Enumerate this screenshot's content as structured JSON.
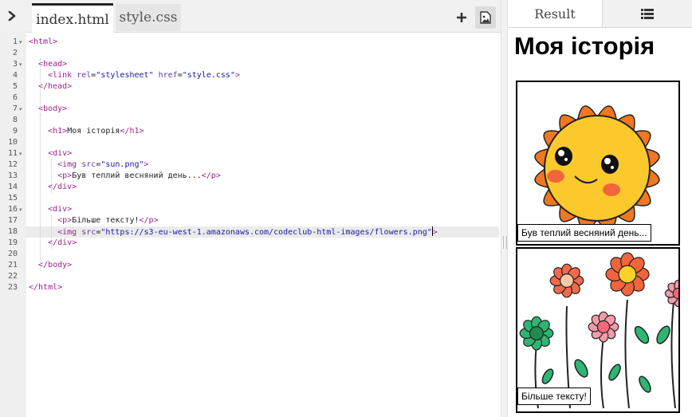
{
  "editor": {
    "tabs": [
      {
        "label": "index.html",
        "active": true
      },
      {
        "label": "style.css",
        "active": false
      }
    ],
    "active_line": 18,
    "lines": [
      {
        "n": "1",
        "fold": true,
        "text": "<html>"
      },
      {
        "n": "2",
        "fold": false,
        "text": ""
      },
      {
        "n": "3",
        "fold": true,
        "text": "  <head>"
      },
      {
        "n": "4",
        "fold": false,
        "text": "    <link rel=\"stylesheet\" href=\"style.css\">"
      },
      {
        "n": "5",
        "fold": false,
        "text": "  </head>"
      },
      {
        "n": "6",
        "fold": false,
        "text": ""
      },
      {
        "n": "7",
        "fold": true,
        "text": "  <body>"
      },
      {
        "n": "8",
        "fold": false,
        "text": ""
      },
      {
        "n": "9",
        "fold": false,
        "text": "    <h1>Моя історія</h1>"
      },
      {
        "n": "10",
        "fold": false,
        "text": ""
      },
      {
        "n": "11",
        "fold": true,
        "text": "    <div>"
      },
      {
        "n": "12",
        "fold": false,
        "text": "      <img src=\"sun.png\">"
      },
      {
        "n": "13",
        "fold": false,
        "text": "      <p>Був теплий весняний день...</p>"
      },
      {
        "n": "14",
        "fold": false,
        "text": "    </div>"
      },
      {
        "n": "15",
        "fold": false,
        "text": ""
      },
      {
        "n": "16",
        "fold": true,
        "text": "    <div>"
      },
      {
        "n": "17",
        "fold": false,
        "text": "      <p>Більше тексту!</p>"
      },
      {
        "n": "18",
        "fold": false,
        "text": "      <img src=\"https://s3-eu-west-1.amazonaws.com/codeclub-html-images/flowers.png\">"
      },
      {
        "n": "19",
        "fold": false,
        "text": "    </div>"
      },
      {
        "n": "20",
        "fold": false,
        "text": ""
      },
      {
        "n": "21",
        "fold": false,
        "text": "  </body>"
      },
      {
        "n": "22",
        "fold": false,
        "text": ""
      },
      {
        "n": "23",
        "fold": false,
        "text": "</html>"
      }
    ]
  },
  "result": {
    "tab_label": "Result",
    "list_icon": "list-icon",
    "page": {
      "title": "Моя історія",
      "cards": [
        {
          "image": "sun-image",
          "caption": "Був теплий весняний день..."
        },
        {
          "image": "flowers-image",
          "caption": "Більше тексту!"
        }
      ]
    }
  },
  "colors": {
    "tag": "#a0238c",
    "attr": "#6f3b9c",
    "string": "#1a1aa6",
    "text": "#222222",
    "sun_ray": "#f07822",
    "sun_face": "#fcc92c",
    "cheek": "#f2643c"
  }
}
